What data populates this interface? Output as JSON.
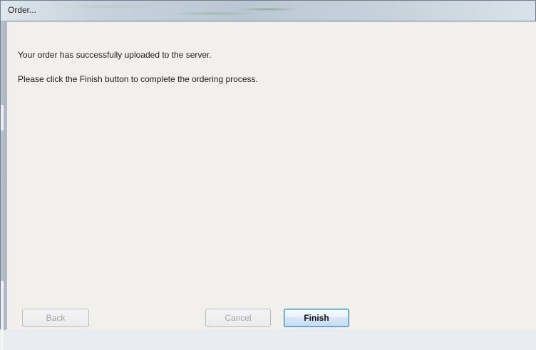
{
  "window": {
    "title": "Order..."
  },
  "messages": {
    "line1": "Your order has successfully uploaded to the server.",
    "line2": "Please click the Finish button to complete the ordering process."
  },
  "buttons": {
    "back": "Back",
    "cancel": "Cancel",
    "finish": "Finish"
  },
  "colors": {
    "client_background": "#f1f0ed",
    "primary_button_border": "#3c7fb1"
  }
}
